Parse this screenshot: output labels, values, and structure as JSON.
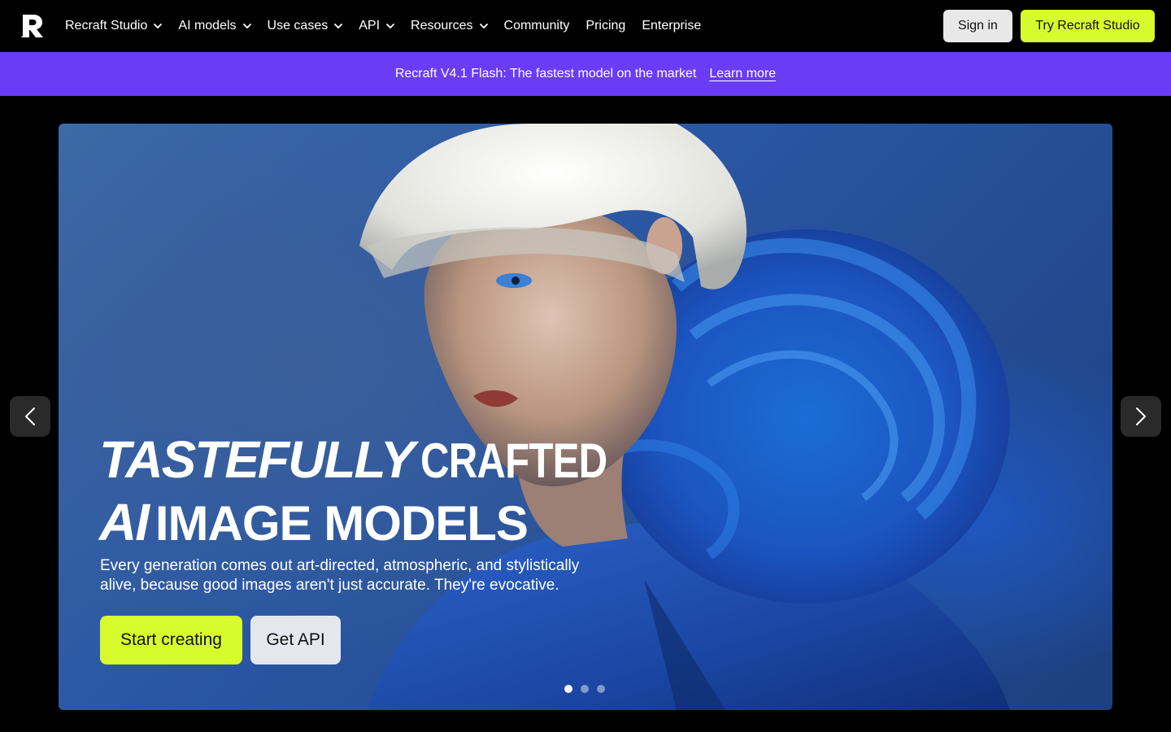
{
  "nav": {
    "items": [
      {
        "label": "Recraft Studio",
        "dropdown": true
      },
      {
        "label": "AI models",
        "dropdown": true
      },
      {
        "label": "Use cases",
        "dropdown": true
      },
      {
        "label": "API",
        "dropdown": true
      },
      {
        "label": "Resources",
        "dropdown": true
      },
      {
        "label": "Community",
        "dropdown": false
      },
      {
        "label": "Pricing",
        "dropdown": false
      },
      {
        "label": "Enterprise",
        "dropdown": false
      }
    ],
    "sign_in_label": "Sign in",
    "try_label": "Try Recraft Studio",
    "logo_icon": "recraft-logo-icon"
  },
  "banner": {
    "text": "Recraft V4.1 Flash: The fastest model on the market",
    "link_label": "Learn more",
    "color": "#6a3cf5"
  },
  "hero": {
    "title_line1_italic": "TASTEFULLY",
    "title_line1_regular": "CRAFTED",
    "title_line2_italic": "AI",
    "title_line2_regular": "IMAGE MODELS",
    "subtitle_line1": "Every generation comes out art-directed, atmospheric, and stylistically",
    "subtitle_line2": "alive, because good images aren't just accurate. They're evocative.",
    "start_label": "Start creating",
    "api_label": "Get API",
    "slides": 3,
    "active_slide": 1
  },
  "colors": {
    "accent": "#d8fb2e",
    "banner": "#6a3cf5",
    "background": "#000000"
  }
}
